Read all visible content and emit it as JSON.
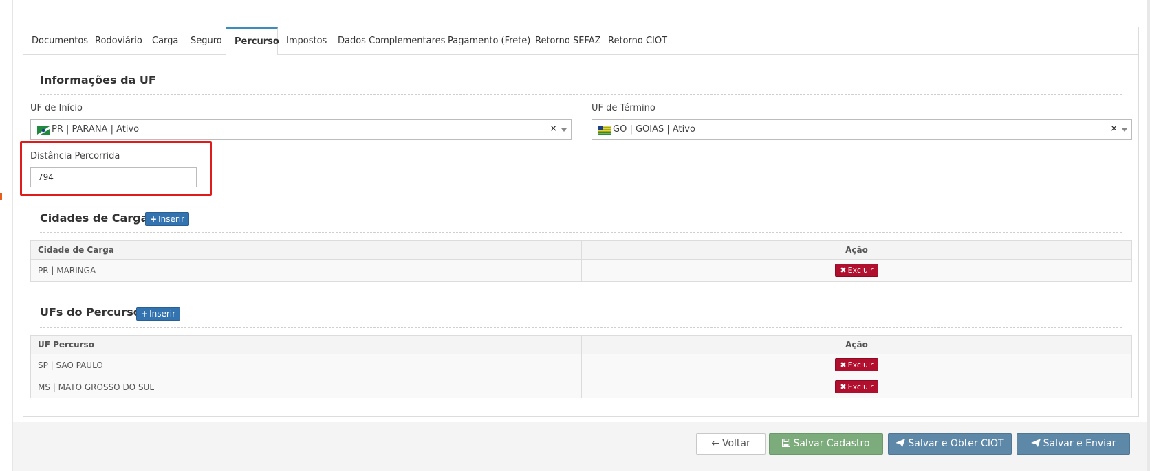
{
  "tabs": [
    {
      "label": "Documentos"
    },
    {
      "label": "Rodoviário"
    },
    {
      "label": "Carga"
    },
    {
      "label": "Seguro"
    },
    {
      "label": "Percurso",
      "active": true
    },
    {
      "label": "Impostos"
    },
    {
      "label": "Dados Complementares"
    },
    {
      "label": "Pagamento (Frete)"
    },
    {
      "label": "Retorno SEFAZ"
    },
    {
      "label": "Retorno CIOT"
    }
  ],
  "uf_info": {
    "title": "Informações da UF",
    "uf_inicio_label": "UF de Início",
    "uf_inicio_value": "PR | PARANA | Ativo",
    "uf_termino_label": "UF de Término",
    "uf_termino_value": "GO | GOIAS | Ativo",
    "clear_symbol": "×",
    "distancia_label": "Distância Percorrida",
    "distancia_value": "794"
  },
  "cidades_carga": {
    "title": "Cidades de Carga",
    "insert_label": "Inserir",
    "col_cidade": "Cidade de Carga",
    "col_acao": "Ação",
    "rows": [
      {
        "cidade": "PR | MARINGA",
        "acao": "Excluir"
      }
    ]
  },
  "ufs_percurso": {
    "title": "UFs do Percurso",
    "insert_label": "Inserir",
    "col_uf": "UF Percurso",
    "col_acao": "Ação",
    "rows": [
      {
        "uf": "SP | SAO PAULO",
        "acao": "Excluir"
      },
      {
        "uf": "MS | MATO GROSSO DO SUL",
        "acao": "Excluir"
      }
    ]
  },
  "footer": {
    "voltar": "Voltar",
    "salvar_cadastro": "Salvar Cadastro",
    "salvar_ciot": "Salvar e Obter CIOT",
    "salvar_enviar": "Salvar e Enviar"
  },
  "icons": {
    "flag_pr": "parana-flag-icon",
    "flag_go": "goias-flag-icon",
    "arrow_left": "arrow-left-icon",
    "floppy": "floppy-disk-icon",
    "paper_plane": "paper-plane-icon",
    "plus": "plus-icon",
    "times": "times-icon"
  },
  "colors": {
    "primary": "#3373b0",
    "danger": "#b0102d",
    "success": "#7cac7c",
    "info": "#5d88a8",
    "highlight": "#e01b1b"
  }
}
